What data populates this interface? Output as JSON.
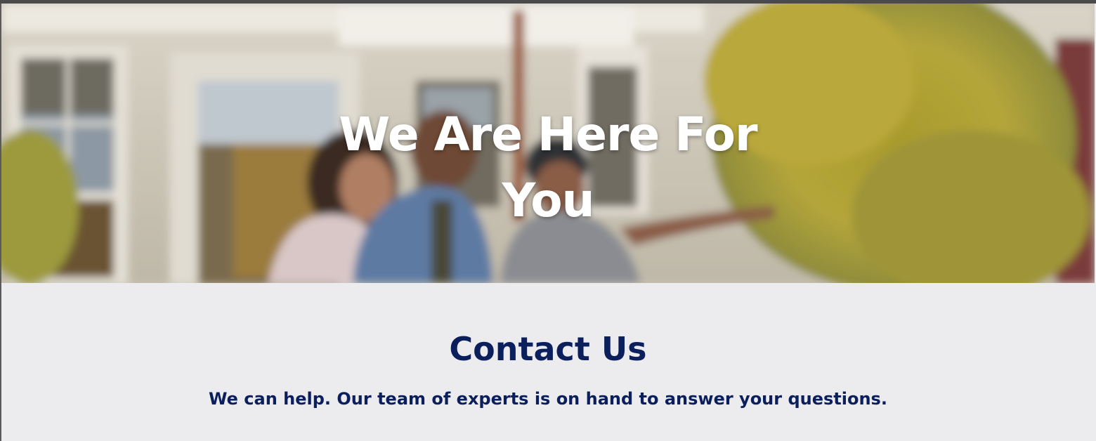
{
  "hero": {
    "title_line1": "We Are Here For",
    "title_line2": "You",
    "image_description_icon": "photo-banner-icon"
  },
  "contact": {
    "title": "Contact Us",
    "subtitle": "We can help. Our team of experts is on hand to answer your questions."
  },
  "colors": {
    "heading_navy": "#0b1f5c",
    "section_bg": "#ecebee",
    "hero_text": "#ffffff"
  }
}
